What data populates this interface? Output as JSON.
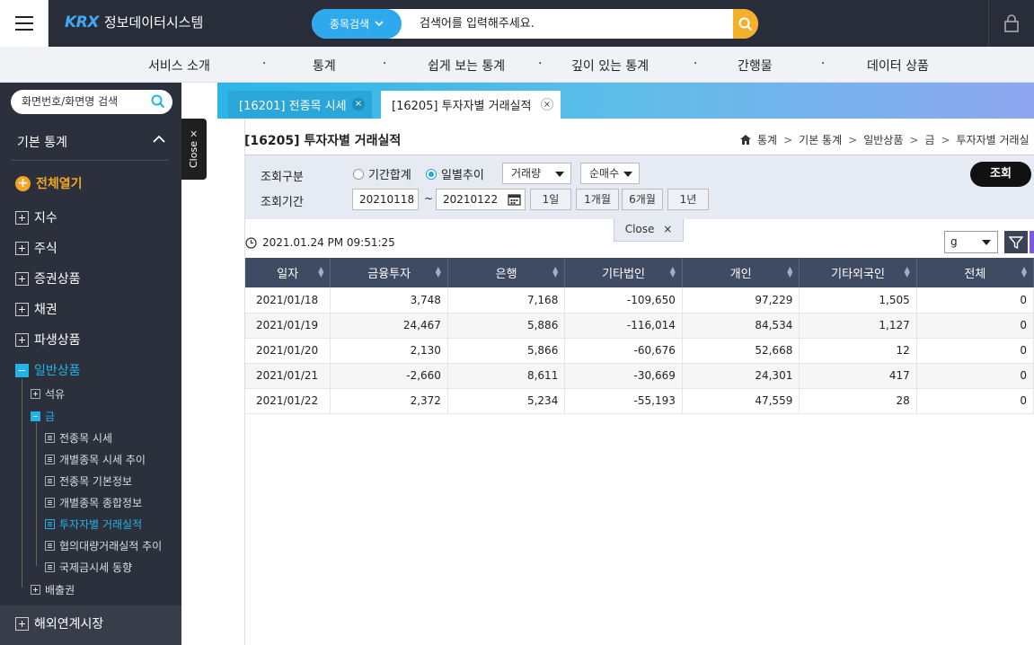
{
  "header": {
    "logo_mark": "KRX",
    "app_title": "정보데이터시스템",
    "search_type": "종목검색",
    "search_placeholder": "검색어를 입력해주세요."
  },
  "nav": {
    "items": [
      "서비스 소개",
      "통계",
      "쉽게 보는 통계",
      "깊이 있는 통계",
      "간행물",
      "데이터 상품"
    ],
    "separator": "·"
  },
  "sidebar": {
    "search_placeholder": "화면번호/화면명 검색",
    "section_title": "기본 통계",
    "expand_all": "전체열기",
    "items": [
      "지수",
      "주식",
      "증권상품",
      "채권",
      "파생상품",
      "일반상품"
    ],
    "sub": {
      "oil": "석유",
      "gold": "금",
      "gold_children": [
        "전종목 시세",
        "개별종목 시세 추이",
        "전종목 기본정보",
        "개별종목 종합정보",
        "투자자별 거래실적",
        "협의대량거래실적 추이",
        "국제금시세 동향"
      ],
      "emission": "배출권"
    },
    "bottom_item": "해외연계시장",
    "close_label": "Close ×"
  },
  "tabs": [
    {
      "label": "[16201] 전종목 시세"
    },
    {
      "label": "[16205] 투자자별 거래실적"
    }
  ],
  "page": {
    "title": "[16205] 투자자별 거래실적",
    "breadcrumb": [
      "통계",
      "기본 통계",
      "일반상품",
      "금",
      "투자자별 거래실"
    ]
  },
  "filter": {
    "query_type_label": "조회구분",
    "radio_period_total": "기간합계",
    "radio_daily": "일별추이",
    "select_volume": "거래량",
    "select_net": "순매수",
    "period_label": "조회기간",
    "date_from": "20210118",
    "date_sep": "~",
    "date_to": "20210122",
    "quick_ranges": [
      "1일",
      "1개월",
      "6개월",
      "1년"
    ],
    "search_button": "조회",
    "close_label": "Close"
  },
  "timestamp": "2021.01.24 PM 09:51:25",
  "unit_select": "g",
  "table": {
    "headers": [
      "일자",
      "금융투자",
      "은행",
      "기타법인",
      "개인",
      "기타외국인",
      "전체"
    ],
    "rows": [
      [
        "2021/01/18",
        "3,748",
        "7,168",
        "-109,650",
        "97,229",
        "1,505",
        "0"
      ],
      [
        "2021/01/19",
        "24,467",
        "5,886",
        "-116,014",
        "84,534",
        "1,127",
        "0"
      ],
      [
        "2021/01/20",
        "2,130",
        "5,866",
        "-60,676",
        "52,668",
        "12",
        "0"
      ],
      [
        "2021/01/21",
        "-2,660",
        "8,611",
        "-30,669",
        "24,301",
        "417",
        "0"
      ],
      [
        "2021/01/22",
        "2,372",
        "5,234",
        "-55,193",
        "47,559",
        "28",
        "0"
      ]
    ]
  },
  "colors": {
    "accent_blue": "#22b3e8",
    "search_orange": "#f3b02b",
    "sidebar_bg": "#2c303d",
    "table_header": "#3f4a63"
  }
}
